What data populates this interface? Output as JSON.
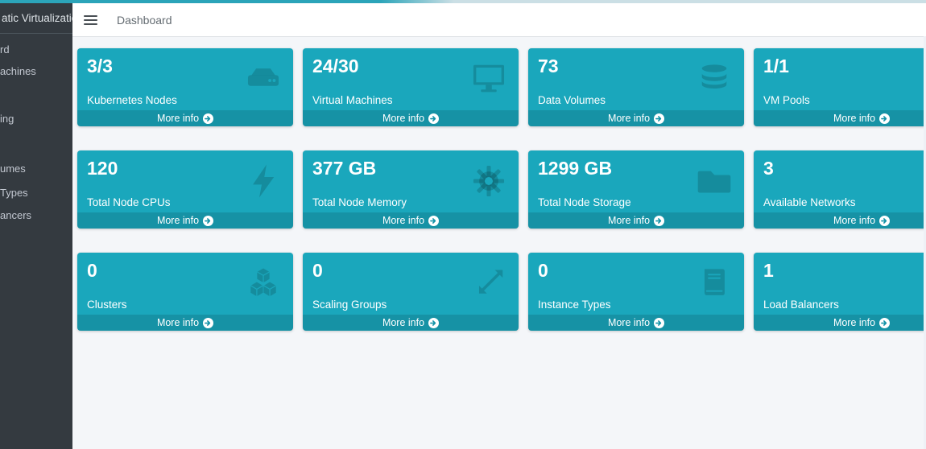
{
  "colors": {
    "accent": "#1aa7bc",
    "card": "#1aa7bc",
    "card_footer": "#1292a7",
    "sidebar_bg": "#343a40",
    "content_bg": "#f4f6f9"
  },
  "sidebar": {
    "brand": "atic Virtualization",
    "items": [
      {
        "label": "rd"
      },
      {
        "label": "achines"
      },
      {
        "label": "ing"
      },
      {
        "label": "umes"
      },
      {
        "label": "Types"
      },
      {
        "label": "ancers"
      }
    ]
  },
  "navbar": {
    "title": "Dashboard"
  },
  "labels": {
    "more_info": "More info"
  },
  "cards": [
    {
      "value": "3/3",
      "label": "Kubernetes Nodes",
      "icon": "hdd-icon"
    },
    {
      "value": "24/30",
      "label": "Virtual Machines",
      "icon": "desktop-icon"
    },
    {
      "value": "73",
      "label": "Data Volumes",
      "icon": "database-icon"
    },
    {
      "value": "1/1",
      "label": "VM Pools",
      "icon": "server-icon"
    },
    {
      "value": "120",
      "label": "Total Node CPUs",
      "icon": "bolt-icon"
    },
    {
      "value": "377 GB",
      "label": "Total Node Memory",
      "icon": "gear-icon"
    },
    {
      "value": "1299 GB",
      "label": "Total Node Storage",
      "icon": "folder-icon"
    },
    {
      "value": "3",
      "label": "Available Networks",
      "icon": "network-icon"
    },
    {
      "value": "0",
      "label": "Clusters",
      "icon": "cubes-icon"
    },
    {
      "value": "0",
      "label": "Scaling Groups",
      "icon": "expand-arrows-icon"
    },
    {
      "value": "0",
      "label": "Instance Types",
      "icon": "book-icon"
    },
    {
      "value": "1",
      "label": "Load Balancers",
      "icon": "sitemap-icon"
    }
  ]
}
